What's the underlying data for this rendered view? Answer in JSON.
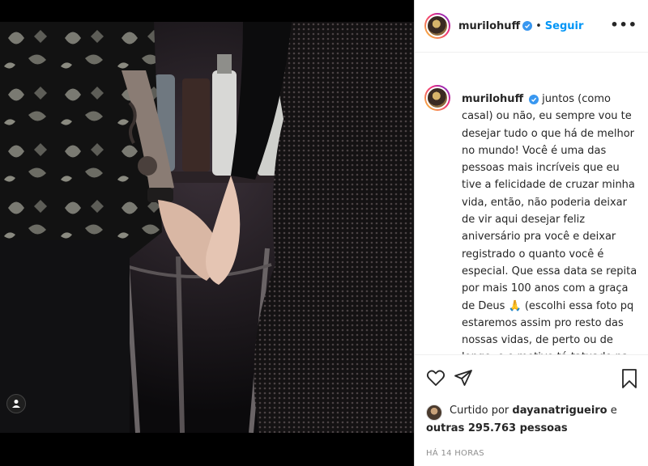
{
  "post": {
    "author": "murilohuff",
    "follow_label": "Seguir",
    "separator": "•",
    "more_label": "•••",
    "caption": "juntos (como casal) ou não, eu sempre vou te desejar tudo o que há de melhor no mundo! Você é uma das pessoas mais incríveis que eu tive a felicidade de cruzar minha vida, então, não poderia deixar de vir aqui desejar feliz aniversário pra você e deixar registrado o quanto você é especial. Que essa data se repita por mais 100 anos com a graça de Deus 🙏 (escolhi essa foto pq estaremos assim pro resto das nossas vidas, de perto ou de longe, e o motivo tá tatuado na gente e também ta na",
    "timestamp": "HÁ 14 HORAS"
  },
  "likes": {
    "prefix": "Curtido por",
    "liker": "dayanatrigueiro",
    "conjunction": "e",
    "others": "outras 295.763 pessoas"
  },
  "icons": {
    "like": "heart-outline-icon",
    "share": "send-icon",
    "save": "bookmark-icon",
    "tags": "user-tag-icon",
    "verified": "verified-badge-icon"
  },
  "colors": {
    "accent": "#0095f6",
    "verified": "#3897f0",
    "text": "#262626",
    "muted": "#8e8e8e"
  }
}
